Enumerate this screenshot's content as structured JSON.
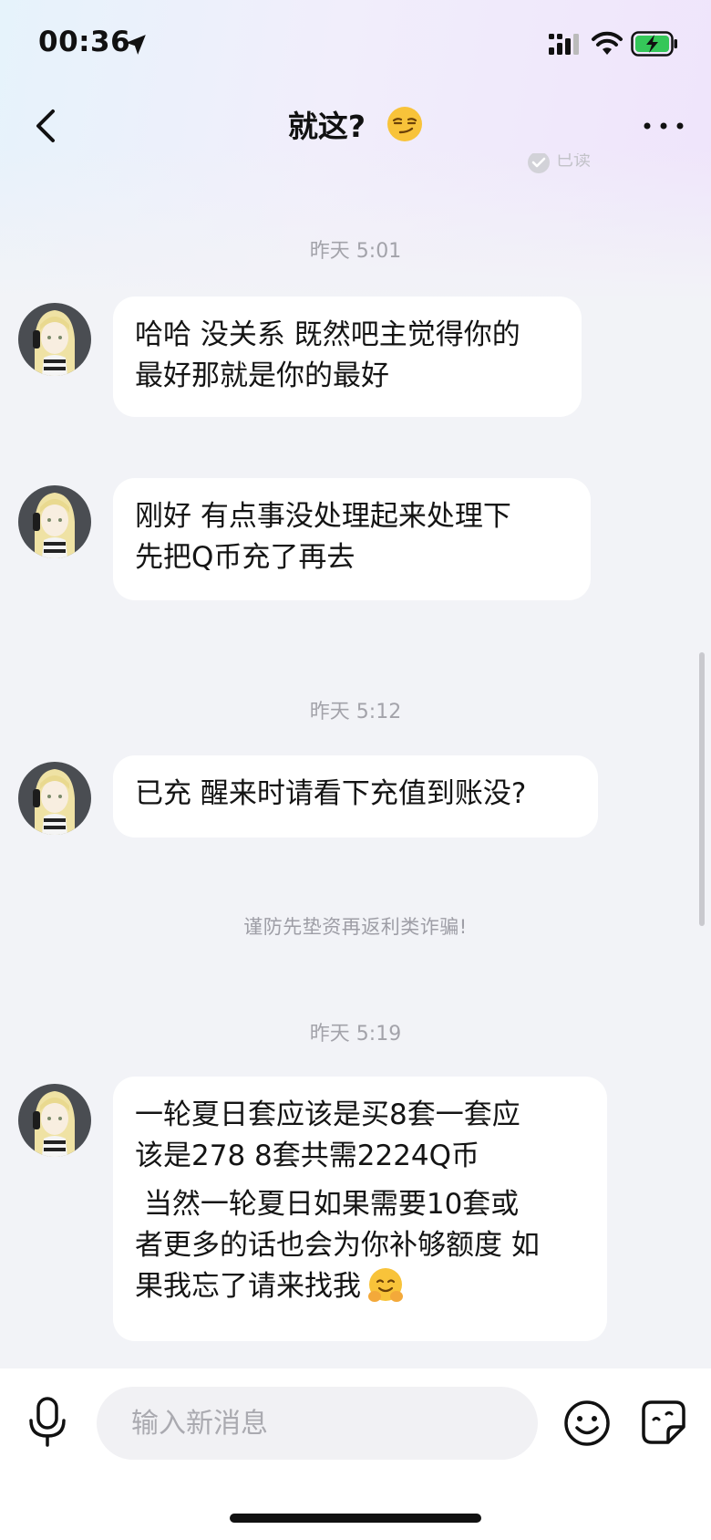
{
  "status_bar": {
    "time": "00:36"
  },
  "header": {
    "title": "就这?"
  },
  "read_receipt": "已读",
  "timestamps": [
    "昨天 5:01",
    "昨天 5:12",
    "昨天 5:19"
  ],
  "messages": [
    {
      "lines": [
        "哈哈 没关系 既然吧主觉得你的",
        "最好那就是你的最好"
      ]
    },
    {
      "lines": [
        "刚好 有点事没处理起来处理下",
        "先把Q币充了再去"
      ]
    },
    {
      "lines": [
        "已充 醒来时请看下充值到账没?"
      ]
    },
    {
      "para1": [
        "一轮夏日套应该是买8套一套应",
        "该是278 8套共需2224Q币"
      ],
      "para2": [
        " 当然一轮夏日如果需要10套或",
        "者更多的话也会为你补够额度 如",
        "果我忘了请来找我"
      ]
    }
  ],
  "notice": "谨防先垫资再返利类诈骗!",
  "input": {
    "placeholder": "输入新消息"
  },
  "colors": {
    "accent_green": "#35c759",
    "bubble": "#ffffff",
    "background": "#f2f3f7"
  }
}
